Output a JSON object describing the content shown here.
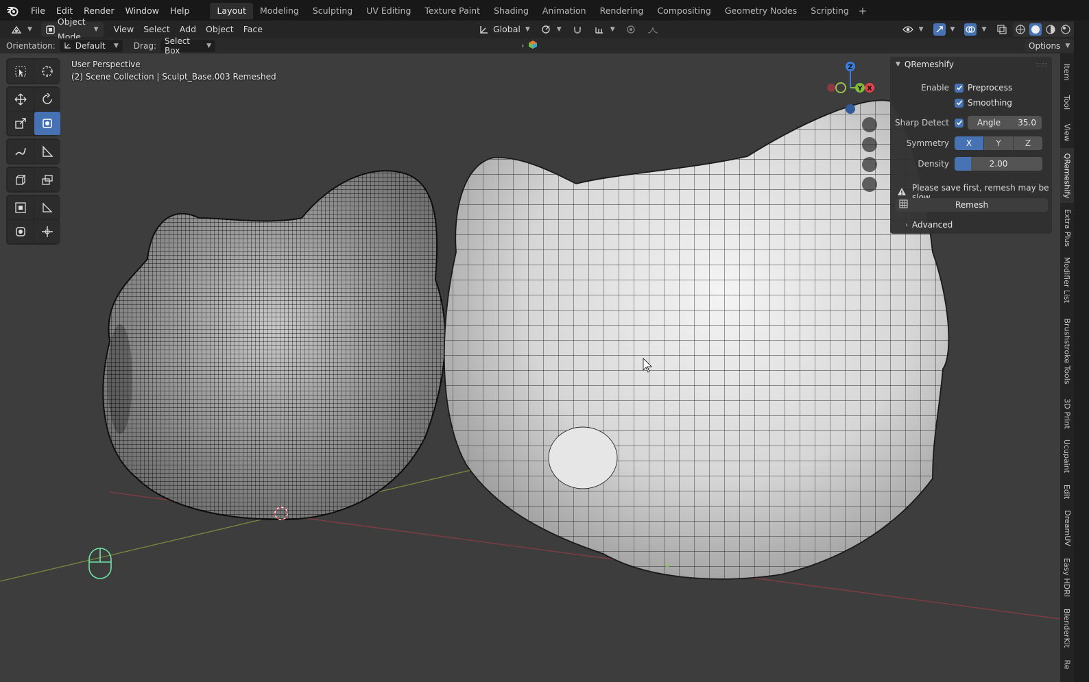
{
  "menu": [
    "File",
    "Edit",
    "Render",
    "Window",
    "Help"
  ],
  "workspaces": [
    {
      "label": "Layout",
      "active": true
    },
    {
      "label": "Modeling",
      "active": false
    },
    {
      "label": "Sculpting",
      "active": false
    },
    {
      "label": "UV Editing",
      "active": false
    },
    {
      "label": "Texture Paint",
      "active": false
    },
    {
      "label": "Shading",
      "active": false
    },
    {
      "label": "Animation",
      "active": false
    },
    {
      "label": "Rendering",
      "active": false
    },
    {
      "label": "Compositing",
      "active": false
    },
    {
      "label": "Geometry Nodes",
      "active": false
    },
    {
      "label": "Scripting",
      "active": false
    }
  ],
  "header": {
    "mode": "Object Mode",
    "menus": [
      "View",
      "Select",
      "Add",
      "Object",
      "Face"
    ],
    "transform_orientation": "Global"
  },
  "toolrow": {
    "orientation_label": "Orientation:",
    "orientation_value": "Default",
    "drag_label": "Drag:",
    "drag_value": "Select Box",
    "options": "Options"
  },
  "viewport": {
    "perspective": "User Perspective",
    "collection": "(2) Scene Collection | Sculpt_Base.003 Remeshed"
  },
  "gizmo": {
    "z": "Z",
    "y": "Y",
    "x": "X"
  },
  "qremeshify": {
    "title": "QRemeshify",
    "enable_label": "Enable",
    "preprocess": "Preprocess",
    "smoothing": "Smoothing",
    "sharp_detect_label": "Sharp Detect",
    "angle_label": "Angle",
    "angle_value": "35.0",
    "symmetry_label": "Symmetry",
    "sym_x": "X",
    "sym_y": "Y",
    "sym_z": "Z",
    "density_label": "Density",
    "density_value": "2.00",
    "warning": "Please save first, remesh may be slow",
    "remesh_button": "Remesh",
    "advanced": "Advanced"
  },
  "sidebar_tabs": [
    "Item",
    "Tool",
    "View",
    "QRemeshify",
    "Extra Plus",
    "Modifier List",
    "Brushstroke Tools",
    "3D Print",
    "Ucupaint",
    "Edit",
    "DreamUV",
    "Easy HDRI",
    "BlenderKit",
    "Re"
  ],
  "colors": {
    "accent": "#4772b3",
    "axis_x": "#e2434f",
    "axis_y": "#7fbd3b",
    "axis_z": "#3c7ee0"
  }
}
